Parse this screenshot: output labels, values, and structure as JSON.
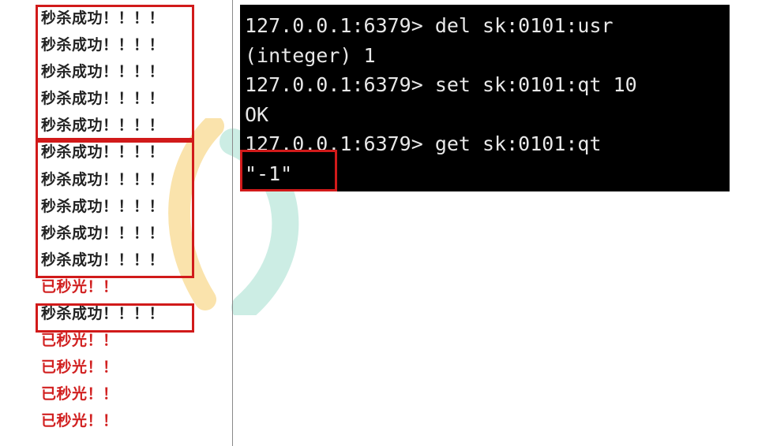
{
  "log": {
    "lines": [
      {
        "text": "秒杀成功！！！！",
        "status": "success"
      },
      {
        "text": "秒杀成功！！！！",
        "status": "success"
      },
      {
        "text": "秒杀成功！！！！",
        "status": "success"
      },
      {
        "text": "秒杀成功！！！！",
        "status": "success"
      },
      {
        "text": "秒杀成功！！！！",
        "status": "success"
      },
      {
        "text": "秒杀成功！！！！",
        "status": "success"
      },
      {
        "text": "秒杀成功！！！！",
        "status": "success"
      },
      {
        "text": "秒杀成功！！！！",
        "status": "success"
      },
      {
        "text": "秒杀成功！！！！",
        "status": "success"
      },
      {
        "text": "秒杀成功！！！！",
        "status": "success"
      },
      {
        "text": "已秒光！！",
        "status": "soldout"
      },
      {
        "text": "秒杀成功！！！！",
        "status": "success"
      },
      {
        "text": "已秒光！！",
        "status": "soldout"
      },
      {
        "text": "已秒光！！",
        "status": "soldout"
      },
      {
        "text": "已秒光！！",
        "status": "soldout"
      },
      {
        "text": "已秒光！！",
        "status": "soldout"
      }
    ]
  },
  "terminal": {
    "lines": [
      "127.0.0.1:6379> del sk:0101:usr",
      "(integer) 1",
      "127.0.0.1:6379> set sk:0101:qt 10",
      "OK",
      "127.0.0.1:6379> get sk:0101:qt",
      "\"-1\""
    ]
  },
  "colors": {
    "highlight": "#d11a1a",
    "success_text": "#222222",
    "soldout_text": "#d12020",
    "terminal_bg": "#000000",
    "terminal_fg": "#e8e8e8"
  }
}
